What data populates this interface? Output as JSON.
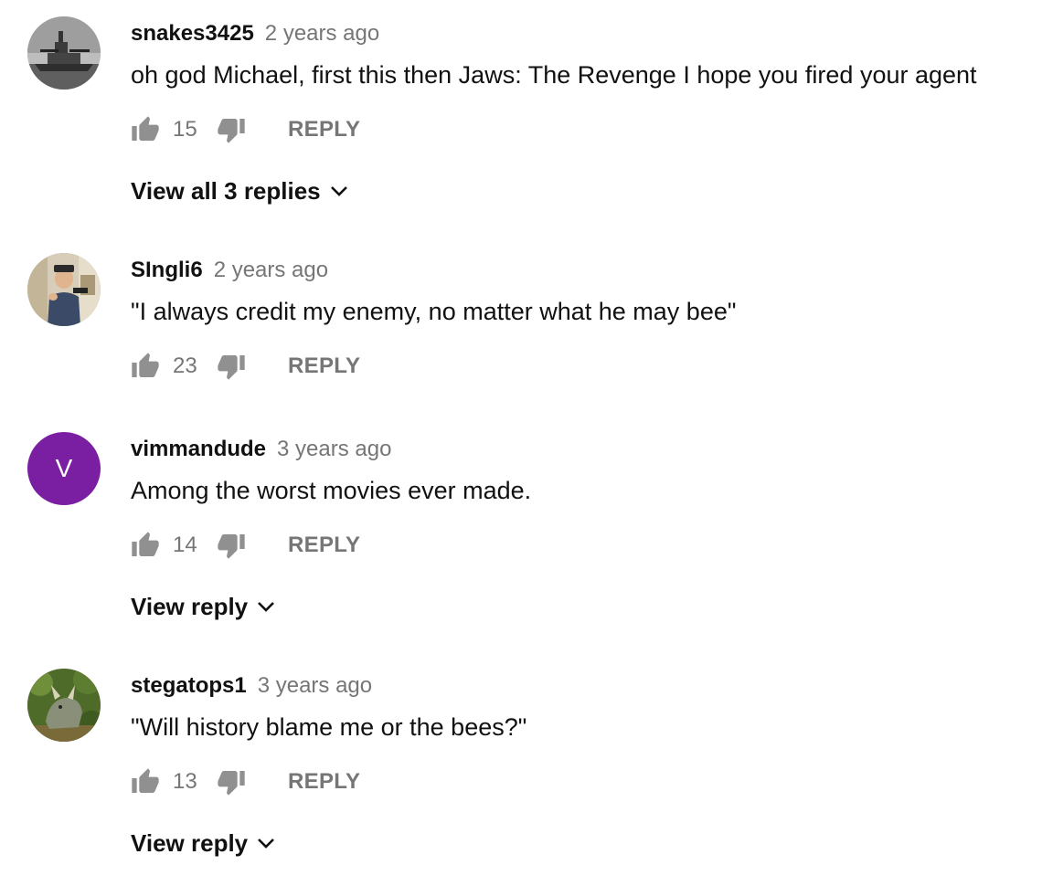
{
  "comments": [
    {
      "author": "snakes3425",
      "time": "2 years ago",
      "text": "oh god Michael, first this then Jaws: The Revenge I hope you fired your agent",
      "likes": "15",
      "reply_label": "REPLY",
      "view_replies": "View all 3 replies",
      "avatar": {
        "type": "image",
        "icon": "battleship-photo"
      }
    },
    {
      "author": "SIngli6",
      "time": "2 years ago",
      "text": "\"I always credit my enemy, no matter what he may bee\"",
      "likes": "23",
      "reply_label": "REPLY",
      "avatar": {
        "type": "image",
        "icon": "person-photo"
      }
    },
    {
      "author": "vimmandude",
      "time": "3 years ago",
      "text": "Among the worst movies ever made.",
      "likes": "14",
      "reply_label": "REPLY",
      "view_replies": "View reply",
      "avatar": {
        "type": "letter",
        "letter": "V",
        "color": "#7b1fa2"
      }
    },
    {
      "author": "stegatops1",
      "time": "3 years ago",
      "text": "\"Will history blame me or the bees?\"",
      "likes": "13",
      "reply_label": "REPLY",
      "view_replies": "View reply",
      "avatar": {
        "type": "image",
        "icon": "dinosaur-photo"
      }
    }
  ],
  "colors": {
    "text": "#111111",
    "secondary": "#767676",
    "icon": "#909090"
  }
}
